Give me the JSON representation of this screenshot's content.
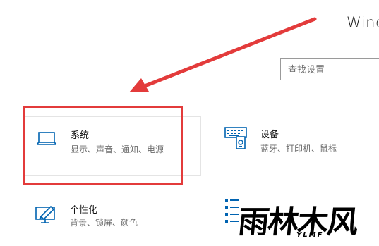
{
  "window": {
    "title": "Wind"
  },
  "search": {
    "placeholder": "查找设置",
    "value": ""
  },
  "tiles": [
    {
      "id": "system",
      "title": "系统",
      "description": "显示、声音、通知、电源",
      "icon": "laptop-icon"
    },
    {
      "id": "devices",
      "title": "设备",
      "description": "蓝牙、打印机、鼠标",
      "icon": "keyboard-device-icon"
    },
    {
      "id": "personalization",
      "title": "个性化",
      "description": "背景、锁屏、颜色",
      "icon": "paint-monitor-icon"
    },
    {
      "id": "apps",
      "title": "",
      "description": "",
      "icon": "apps-list-icon"
    }
  ],
  "annotation": {
    "highlight_color": "#e33b3b",
    "target": "system"
  },
  "colors": {
    "accent": "#0063b1",
    "highlight": "#e33b3b"
  },
  "watermark": {
    "mark": "雨林木风",
    "sub": "YLMF"
  }
}
